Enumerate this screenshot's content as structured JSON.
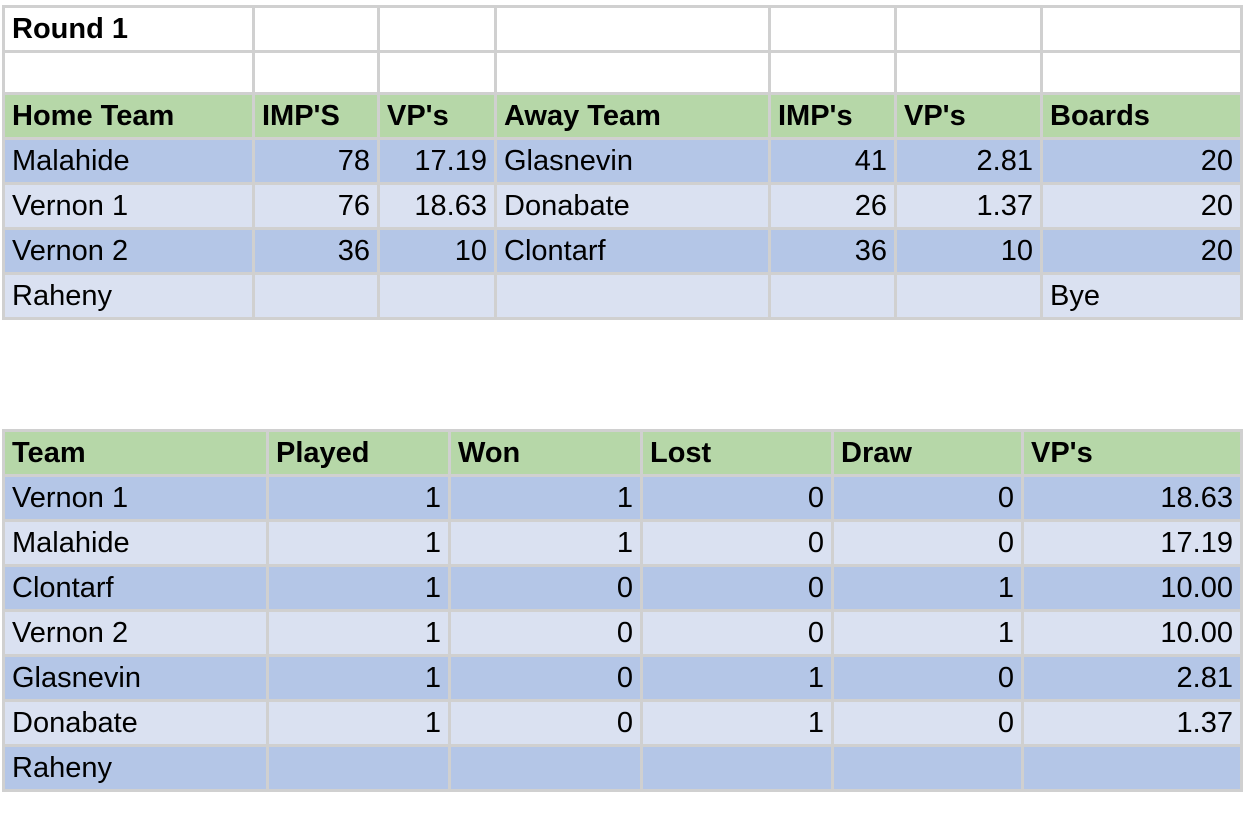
{
  "round_table": {
    "title": "Round 1",
    "headers": [
      "Home Team",
      "IMP'S",
      "VP's",
      "Away Team",
      "IMP's",
      "VP's",
      "Boards"
    ],
    "rows": [
      {
        "home_team": "Malahide",
        "home_imps": "78",
        "home_vps": "17.19",
        "away_team": "Glasnevin",
        "away_imps": "41",
        "away_vps": "2.81",
        "boards": "20"
      },
      {
        "home_team": "Vernon 1",
        "home_imps": "76",
        "home_vps": "18.63",
        "away_team": "Donabate",
        "away_imps": "26",
        "away_vps": "1.37",
        "boards": "20"
      },
      {
        "home_team": "Vernon 2",
        "home_imps": "36",
        "home_vps": "10",
        "away_team": "Clontarf",
        "away_imps": "36",
        "away_vps": "10",
        "boards": "20"
      },
      {
        "home_team": "Raheny",
        "home_imps": "",
        "home_vps": "",
        "away_team": "",
        "away_imps": "",
        "away_vps": "",
        "boards": "Bye"
      }
    ]
  },
  "standings_table": {
    "headers": [
      "Team",
      "Played",
      "Won",
      "Lost",
      "Draw",
      "VP's"
    ],
    "rows": [
      {
        "team": "Vernon 1",
        "played": "1",
        "won": "1",
        "lost": "0",
        "draw": "0",
        "vps": "18.63"
      },
      {
        "team": "Malahide",
        "played": "1",
        "won": "1",
        "lost": "0",
        "draw": "0",
        "vps": "17.19"
      },
      {
        "team": "Clontarf",
        "played": "1",
        "won": "0",
        "lost": "0",
        "draw": "1",
        "vps": "10.00"
      },
      {
        "team": "Vernon 2",
        "played": "1",
        "won": "0",
        "lost": "0",
        "draw": "1",
        "vps": "10.00"
      },
      {
        "team": "Glasnevin",
        "played": "1",
        "won": "0",
        "lost": "1",
        "draw": "0",
        "vps": "2.81"
      },
      {
        "team": "Donabate",
        "played": "1",
        "won": "0",
        "lost": "1",
        "draw": "0",
        "vps": "1.37"
      },
      {
        "team": "Raheny",
        "played": "",
        "won": "",
        "lost": "",
        "draw": "",
        "vps": ""
      }
    ]
  },
  "colors": {
    "header_green": "#b6d7a8",
    "band_dark_blue": "#b4c6e7",
    "band_light_blue": "#dae1f1",
    "grid": "#d0d0d0"
  }
}
